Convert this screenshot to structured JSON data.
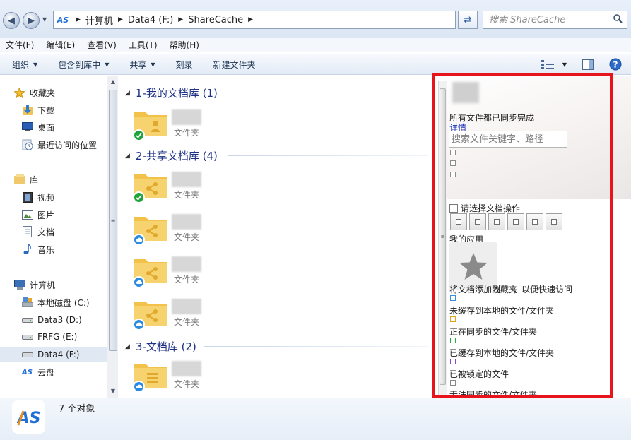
{
  "address_bar": {
    "segments": [
      "计算机",
      "Data4 (F:)",
      "ShareCache"
    ],
    "search_placeholder": "搜索 ShareCache"
  },
  "menu": [
    "文件(F)",
    "编辑(E)",
    "查看(V)",
    "工具(T)",
    "帮助(H)"
  ],
  "toolbar": {
    "organize": "组织",
    "include_in_library": "包含到库中",
    "share": "共享",
    "burn": "刻录",
    "new_folder": "新建文件夹"
  },
  "nav": {
    "favorites": {
      "header": "收藏夹",
      "items": [
        "下载",
        "桌面",
        "最近访问的位置"
      ]
    },
    "libraries": {
      "header": "库",
      "items": [
        "视频",
        "图片",
        "文档",
        "音乐"
      ]
    },
    "computer": {
      "header": "计算机",
      "items": [
        "本地磁盘 (C:)",
        "Data3 (D:)",
        "FRFG (E:)",
        "Data4 (F:)",
        "云盘"
      ]
    }
  },
  "groups": [
    {
      "title": "1-我的文档库 (1)",
      "items": [
        {
          "type": "文件夹",
          "status": "synced",
          "kind": "personal"
        }
      ]
    },
    {
      "title": "2-共享文档库 (4)",
      "items": [
        {
          "type": "文件夹",
          "status": "synced",
          "kind": "shared"
        },
        {
          "type": "文件夹",
          "status": "cloud",
          "kind": "shared"
        },
        {
          "type": "文件夹",
          "status": "cloud",
          "kind": "shared"
        },
        {
          "type": "文件夹",
          "status": "cloud",
          "kind": "shared"
        }
      ]
    },
    {
      "title": "3-文档库 (2)",
      "items": [
        {
          "type": "文件夹",
          "status": "cloud",
          "kind": "doc"
        }
      ]
    }
  ],
  "panel": {
    "sync_status": "所有文件都已同步完成",
    "details_link": "详情",
    "search_placeholder": "搜索文件关键字、路径",
    "select_label": "请选择文档操作",
    "my_apps": "我的应用",
    "add_quick_access_a": "将文档添加到",
    "add_quick_access_b": "收藏夹",
    "add_quick_access_c": "，以便快速访问",
    "legend": [
      {
        "label": "未缓存到本地的文件/文件夹",
        "color": "#3a8de0"
      },
      {
        "label": "正在同步的文件/文件夹",
        "color": "#e0a020"
      },
      {
        "label": "已缓存到本地的文件/文件夹",
        "color": "#2aa84a"
      },
      {
        "label": "已被锁定的文件",
        "color": "#8a4ab8"
      },
      {
        "label": "无法同步的文件/文件夹",
        "color": "#888888"
      }
    ]
  },
  "details": {
    "count": "7 个对象"
  },
  "colors": {
    "accent": "#1e3287",
    "frame": "#e7141b",
    "folder": "#f3c24a"
  }
}
